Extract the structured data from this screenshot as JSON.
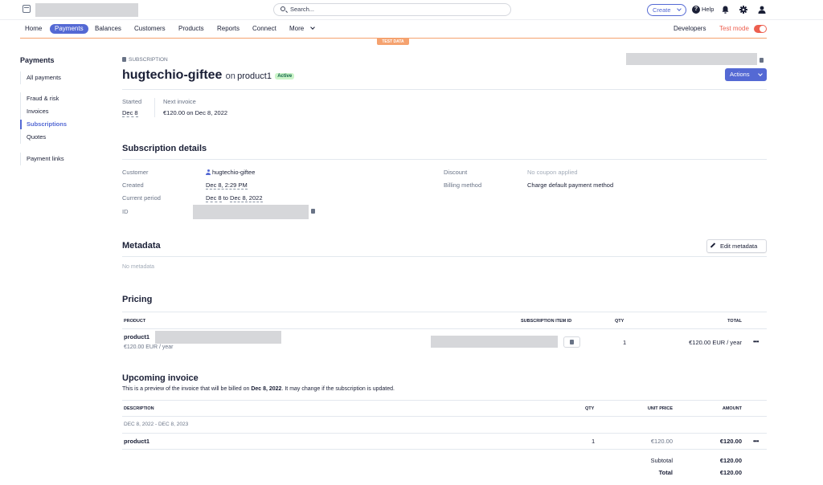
{
  "topbar": {
    "search_placeholder": "Search...",
    "create_label": "Create",
    "help_label": "Help"
  },
  "nav": {
    "items": [
      "Home",
      "Payments",
      "Balances",
      "Customers",
      "Products",
      "Reports",
      "Connect",
      "More"
    ],
    "active": "Payments",
    "developers_label": "Developers",
    "test_mode_label": "Test mode",
    "test_data_banner": "TEST DATA"
  },
  "sidebar": {
    "title": "Payments",
    "items": [
      {
        "label": "All payments"
      },
      {
        "label": "Fraud & risk"
      },
      {
        "label": "Invoices"
      },
      {
        "label": "Subscriptions"
      },
      {
        "label": "Quotes"
      },
      {
        "label": "Payment links"
      }
    ]
  },
  "header": {
    "kicker": "SUBSCRIPTION",
    "customer": "hugtechio-giftee",
    "on_text": "on",
    "product": "product1",
    "status": "Active",
    "actions_label": "Actions",
    "started_label": "Started",
    "started_value": "Dec 8",
    "next_invoice_label": "Next invoice",
    "next_invoice_value": "€120.00 on Dec 8, 2022"
  },
  "details": {
    "title": "Subscription details",
    "customer_label": "Customer",
    "customer_value": "hugtechio-giftee",
    "created_label": "Created",
    "created_value": "Dec 8, 2:29 PM",
    "period_label": "Current period",
    "period_start": "Dec 8",
    "period_to": "to",
    "period_end": "Dec 8, 2022",
    "id_label": "ID",
    "discount_label": "Discount",
    "discount_value": "No coupon applied",
    "billing_label": "Billing method",
    "billing_value": "Charge default payment method"
  },
  "metadata": {
    "title": "Metadata",
    "edit_label": "Edit metadata",
    "empty": "No metadata"
  },
  "pricing": {
    "title": "Pricing",
    "headers": {
      "product": "PRODUCT",
      "item_id": "SUBSCRIPTION ITEM ID",
      "qty": "QTY",
      "total": "TOTAL"
    },
    "row": {
      "product": "product1",
      "price": "€120.00 EUR / year",
      "qty": "1",
      "total": "€120.00 EUR / year"
    }
  },
  "upcoming": {
    "title": "Upcoming invoice",
    "desc_pre": "This is a preview of the invoice that will be billed on",
    "desc_date": "Dec 8, 2022",
    "desc_post": ". It may change if the subscription is updated.",
    "headers": {
      "description": "DESCRIPTION",
      "qty": "QTY",
      "unit_price": "UNIT PRICE",
      "amount": "AMOUNT"
    },
    "period": "DEC 8, 2022 - DEC 8, 2023",
    "row": {
      "description": "product1",
      "qty": "1",
      "unit_price": "€120.00",
      "amount": "€120.00"
    },
    "subtotal_label": "Subtotal",
    "subtotal_value": "€120.00",
    "total_label": "Total",
    "total_value": "€120.00"
  },
  "colors": {
    "accent": "#5469d4",
    "test_mode": "#ed5f4f",
    "test_banner": "#f5a26f",
    "active_badge_bg": "#cbf4c9"
  }
}
